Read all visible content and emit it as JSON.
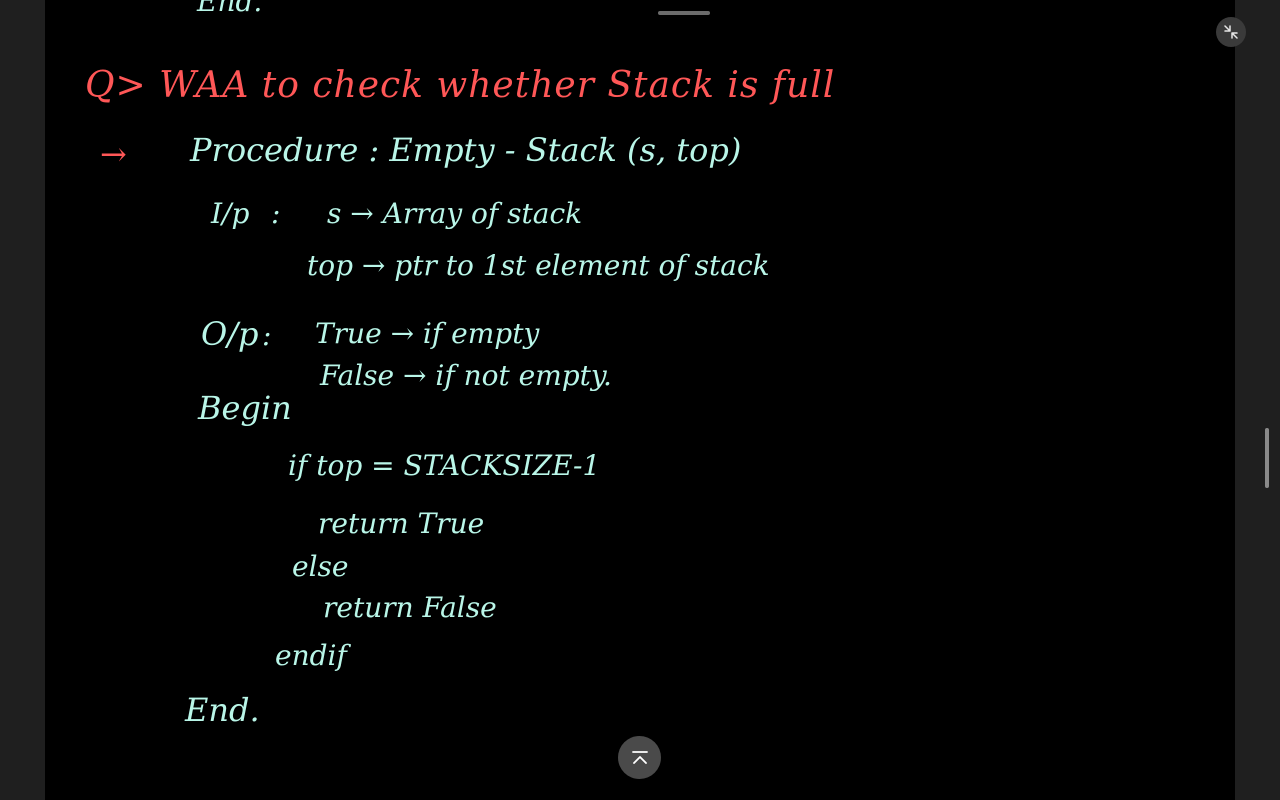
{
  "notes": {
    "previous_end": "End.",
    "question": "Q> WAA to check whether Stack is full",
    "arrow": "→",
    "procedure": "Procedure : Empty - Stack (s, top)",
    "input_label": "I/p",
    "colon_1": ":",
    "input_s": "s → Array of stack",
    "input_top": "top → ptr to 1st element of stack",
    "output_label": "O/p",
    "colon_2": ":",
    "output_true": "True → if empty",
    "output_false": "False → if not empty.",
    "begin": "Begin",
    "if_line": "if   top = STACKSIZE-1",
    "return_true": "return True",
    "else_line": "else",
    "return_false": "return False",
    "endif_line": "endif",
    "end_line": "End."
  },
  "controls": {
    "collapse_icon": "collapse-icon",
    "scroll_top_icon": "chevron-up-icon"
  },
  "colors": {
    "question": "#ff5757",
    "body": "#b9f6e8",
    "page": "#000000",
    "chrome": "#1f1f1f"
  }
}
